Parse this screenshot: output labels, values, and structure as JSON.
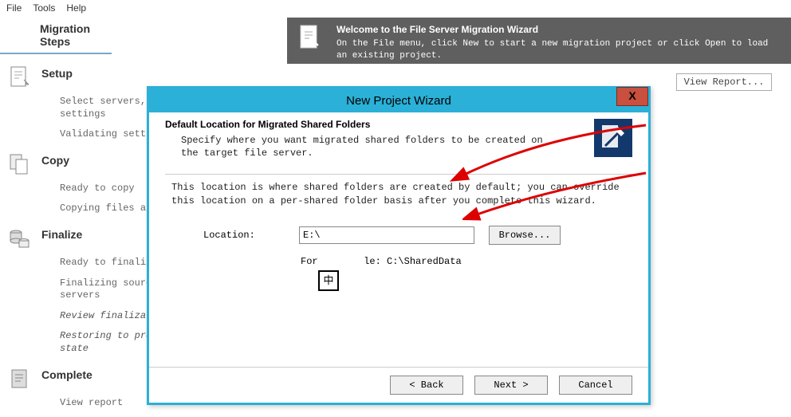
{
  "menu": {
    "file": "File",
    "tools": "Tools",
    "help": "Help"
  },
  "sidebar": {
    "header": "Migration Steps",
    "steps": [
      {
        "title": "Setup",
        "subs": [
          "Select servers,\nsettings",
          "Validating setti"
        ]
      },
      {
        "title": "Copy",
        "subs": [
          "Ready to copy",
          "Copying files an"
        ]
      },
      {
        "title": "Finalize",
        "subs": [
          "Ready to finaliz",
          "Finalizing sourc\nservers",
          "Review finalization",
          "Restoring to pre-fin\nstate"
        ]
      },
      {
        "title": "Complete",
        "subs": [
          "View report"
        ]
      }
    ]
  },
  "banner": {
    "title": "Welcome to the File Server Migration Wizard",
    "desc": "On the File menu, click New to start a new migration project or click Open to load an existing project."
  },
  "view_report": "View Report...",
  "dialog": {
    "title": "New Project Wizard",
    "close": "X",
    "heading": "Default Location for Migrated Shared Folders",
    "subheading": "Specify where you want migrated shared folders to be created on the target file server.",
    "info": "This location is where shared folders are created by default; you can override this location on a per-shared folder basis after you complete this wizard.",
    "location_label": "Location:",
    "location_value": "E:\\",
    "browse": "Browse...",
    "example_prefix": "For",
    "example_suffix": "le:  C:\\SharedData",
    "ime": "中",
    "back": "< Back",
    "next": "Next >",
    "cancel": "Cancel"
  }
}
